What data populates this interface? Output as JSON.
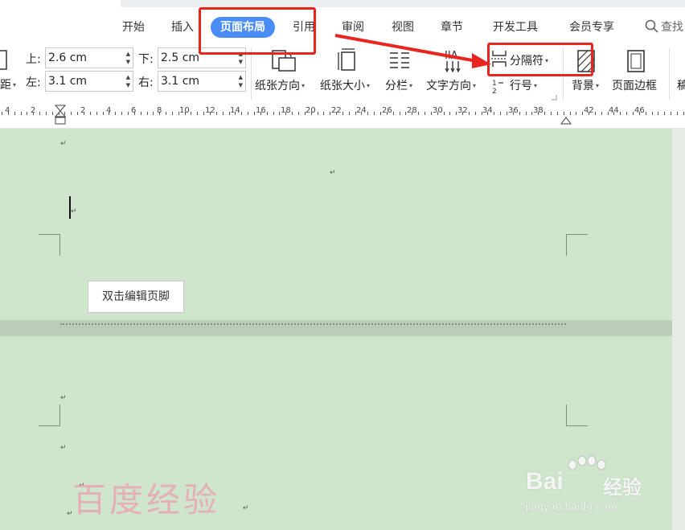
{
  "tabs": [
    {
      "label": "开始",
      "active": false
    },
    {
      "label": "插入",
      "active": false
    },
    {
      "label": "页面布局",
      "active": true
    },
    {
      "label": "引用",
      "active": false
    },
    {
      "label": "审阅",
      "active": false
    },
    {
      "label": "视图",
      "active": false
    },
    {
      "label": "章节",
      "active": false
    },
    {
      "label": "开发工具",
      "active": false
    },
    {
      "label": "会员专享",
      "active": false
    }
  ],
  "search": {
    "label": "查找"
  },
  "margins": {
    "top": {
      "label": "上:",
      "value": "2.6 cm"
    },
    "bottom": {
      "label": "下:",
      "value": "2.5 cm"
    },
    "left": {
      "label": "左:",
      "value": "3.1 cm"
    },
    "right": {
      "label": "右:",
      "value": "3.1 cm"
    },
    "partial_label": "距"
  },
  "tools": {
    "orientation": "纸张方向",
    "size": "纸张大小",
    "columns": "分栏",
    "text_direction": "文字方向",
    "breaks": "分隔符",
    "line_numbers": "行号",
    "background": "背景",
    "page_border": "页面边框",
    "partial": "稿"
  },
  "ruler": {
    "numbers": [
      "4",
      "2",
      "2",
      "4",
      "6",
      "8",
      "10",
      "12",
      "14",
      "16",
      "18",
      "20",
      "22",
      "24",
      "26",
      "28",
      "30",
      "32",
      "34",
      "36",
      "38",
      "42",
      "44",
      "46"
    ]
  },
  "document": {
    "footer_button": "双击编辑页脚"
  },
  "watermark": {
    "text": "百度经验",
    "brand": "Bai",
    "brand_suffix": "经验",
    "url": "jingyan.baidu.com"
  },
  "colors": {
    "accent": "#4a8df8",
    "annotation": "#e8261f",
    "page": "#cfe6cd"
  }
}
